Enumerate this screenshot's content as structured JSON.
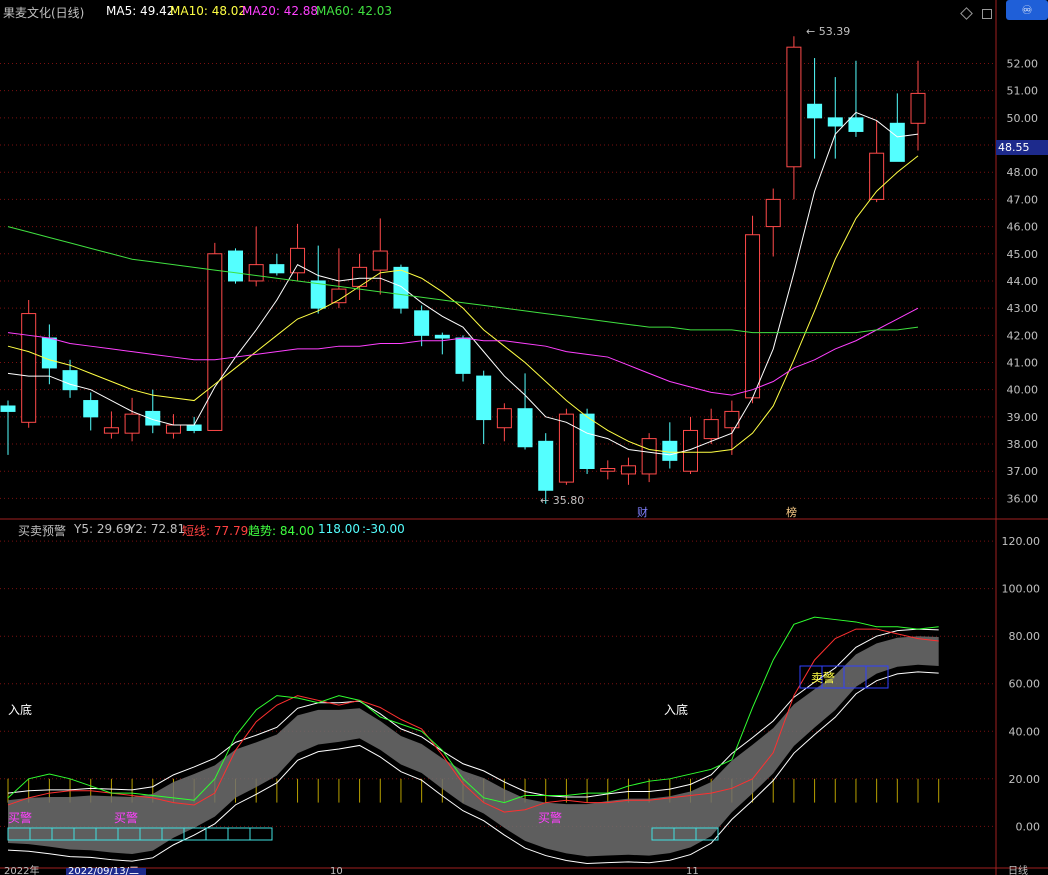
{
  "header": {
    "stock_name": "果麦文化(日线)",
    "ma5": "MA5: 49.42",
    "ma10": "MA10: 48.02",
    "ma20": "MA20: 42.88",
    "ma60": "MA60: 42.03"
  },
  "indicator_header": {
    "name": "买卖预警",
    "y5": "Y5: 29.69",
    "y2": "Y2: 72.81",
    "short": "短线: 77.79",
    "trend": "趋势: 84.00",
    "v118": "118.00",
    "vneg30": ":-30.00"
  },
  "current_price": "48.55",
  "labels": {
    "high": "53.39",
    "low": "35.80",
    "cai": "财",
    "bang": "榜",
    "ru_di_1": "入底",
    "ru_di_2": "入底",
    "mai_jing_1": "买警",
    "mai_jing_2": "买警",
    "mai_jing_3": "买警",
    "mai_jing_sell": "卖警",
    "bottom_left": "2022年",
    "bottom_date": "2022/09/13/二",
    "bottom_mid1": "10",
    "bottom_mid2": "11",
    "bottom_right": "日线"
  },
  "colors": {
    "up": "#ff4a4a",
    "down": "#54ffff",
    "ma5": "#ffffff",
    "ma10": "#ffff44",
    "ma20": "#ff40ff",
    "ma60": "#40e040",
    "grid": "#7a1010"
  },
  "chart_data": [
    {
      "type": "candlestick",
      "title": "果麦文化(日线)",
      "y_ticks": [
        36,
        37,
        38,
        39,
        40,
        41,
        42,
        43,
        44,
        45,
        46,
        47,
        48,
        49,
        50,
        51,
        52
      ],
      "ylim": [
        35.5,
        53.6
      ],
      "candles": [
        {
          "o": 39.4,
          "h": 39.6,
          "l": 37.6,
          "c": 39.2
        },
        {
          "o": 38.8,
          "h": 43.3,
          "l": 38.6,
          "c": 42.8
        },
        {
          "o": 41.9,
          "h": 42.4,
          "l": 40.2,
          "c": 40.8
        },
        {
          "o": 40.7,
          "h": 41.1,
          "l": 39.7,
          "c": 40.0
        },
        {
          "o": 39.6,
          "h": 39.9,
          "l": 38.5,
          "c": 39.0
        },
        {
          "o": 38.4,
          "h": 39.2,
          "l": 38.2,
          "c": 38.6
        },
        {
          "o": 38.4,
          "h": 39.7,
          "l": 38.1,
          "c": 39.1
        },
        {
          "o": 39.2,
          "h": 40.0,
          "l": 38.4,
          "c": 38.7
        },
        {
          "o": 38.4,
          "h": 39.1,
          "l": 38.2,
          "c": 38.7
        },
        {
          "o": 38.7,
          "h": 39.0,
          "l": 38.4,
          "c": 38.5
        },
        {
          "o": 38.5,
          "h": 45.4,
          "l": 38.5,
          "c": 45.0
        },
        {
          "o": 45.1,
          "h": 45.2,
          "l": 43.9,
          "c": 44.0
        },
        {
          "o": 44.0,
          "h": 46.0,
          "l": 43.8,
          "c": 44.6
        },
        {
          "o": 44.6,
          "h": 45.0,
          "l": 44.2,
          "c": 44.3
        },
        {
          "o": 44.3,
          "h": 46.1,
          "l": 44.0,
          "c": 45.2
        },
        {
          "o": 44.0,
          "h": 45.3,
          "l": 42.8,
          "c": 43.0
        },
        {
          "o": 43.2,
          "h": 45.2,
          "l": 43.0,
          "c": 43.7
        },
        {
          "o": 43.8,
          "h": 45.0,
          "l": 43.3,
          "c": 44.5
        },
        {
          "o": 44.4,
          "h": 46.3,
          "l": 43.5,
          "c": 45.1
        },
        {
          "o": 44.5,
          "h": 44.6,
          "l": 42.8,
          "c": 43.0
        },
        {
          "o": 42.9,
          "h": 43.1,
          "l": 41.6,
          "c": 42.0
        },
        {
          "o": 42.0,
          "h": 42.1,
          "l": 41.3,
          "c": 41.9
        },
        {
          "o": 41.9,
          "h": 42.0,
          "l": 40.3,
          "c": 40.6
        },
        {
          "o": 40.5,
          "h": 40.7,
          "l": 38.0,
          "c": 38.9
        },
        {
          "o": 38.6,
          "h": 39.5,
          "l": 38.1,
          "c": 39.3
        },
        {
          "o": 39.3,
          "h": 40.6,
          "l": 37.8,
          "c": 37.9
        },
        {
          "o": 38.1,
          "h": 38.4,
          "l": 35.8,
          "c": 36.3
        },
        {
          "o": 36.6,
          "h": 39.3,
          "l": 36.5,
          "c": 39.1
        },
        {
          "o": 39.1,
          "h": 39.3,
          "l": 36.9,
          "c": 37.1
        },
        {
          "o": 37.0,
          "h": 37.4,
          "l": 36.7,
          "c": 37.1
        },
        {
          "o": 36.9,
          "h": 37.5,
          "l": 36.5,
          "c": 37.2
        },
        {
          "o": 36.9,
          "h": 38.4,
          "l": 36.6,
          "c": 38.2
        },
        {
          "o": 38.1,
          "h": 38.8,
          "l": 37.1,
          "c": 37.4
        },
        {
          "o": 37.0,
          "h": 39.0,
          "l": 36.9,
          "c": 38.5
        },
        {
          "o": 38.2,
          "h": 39.3,
          "l": 38.0,
          "c": 38.9
        },
        {
          "o": 38.6,
          "h": 39.6,
          "l": 37.6,
          "c": 39.2
        },
        {
          "o": 39.7,
          "h": 46.4,
          "l": 39.5,
          "c": 45.7
        },
        {
          "o": 46.0,
          "h": 47.4,
          "l": 44.9,
          "c": 47.0
        },
        {
          "o": 48.2,
          "h": 53.0,
          "l": 47.0,
          "c": 52.6
        },
        {
          "o": 50.5,
          "h": 52.2,
          "l": 48.5,
          "c": 50.0
        },
        {
          "o": 50.0,
          "h": 51.5,
          "l": 48.5,
          "c": 49.7
        },
        {
          "o": 50.0,
          "h": 52.1,
          "l": 49.3,
          "c": 49.5
        },
        {
          "o": 47.0,
          "h": 49.9,
          "l": 46.9,
          "c": 48.7
        },
        {
          "o": 49.8,
          "h": 50.9,
          "l": 48.5,
          "c": 48.4
        },
        {
          "o": 49.8,
          "h": 52.1,
          "l": 48.8,
          "c": 50.9
        }
      ],
      "series": [
        {
          "name": "MA5",
          "values": [
            40.6,
            40.5,
            40.5,
            40.2,
            40.0,
            39.6,
            39.2,
            38.9,
            38.7,
            38.7,
            40.1,
            41.2,
            42.2,
            43.3,
            44.6,
            44.2,
            44.0,
            44.1,
            44.1,
            43.8,
            43.2,
            42.7,
            42.3,
            41.4,
            40.5,
            39.8,
            39.0,
            38.8,
            38.4,
            38.2,
            37.8,
            37.7,
            37.6,
            37.8,
            38.1,
            38.4,
            39.7,
            41.5,
            44.3,
            47.3,
            49.4,
            50.2,
            49.9,
            49.3,
            49.4
          ]
        },
        {
          "name": "MA10",
          "values": [
            41.6,
            41.4,
            41.1,
            40.9,
            40.6,
            40.3,
            40.0,
            39.8,
            39.7,
            39.6,
            40.2,
            40.8,
            41.4,
            42.0,
            42.6,
            42.9,
            43.3,
            43.8,
            44.3,
            44.4,
            44.1,
            43.6,
            43.0,
            42.2,
            41.6,
            41.0,
            40.3,
            39.6,
            39.0,
            38.5,
            38.1,
            37.8,
            37.7,
            37.7,
            37.7,
            37.8,
            38.4,
            39.4,
            41.1,
            42.9,
            44.8,
            46.3,
            47.3,
            48.0,
            48.6
          ]
        },
        {
          "name": "MA20",
          "values": [
            42.1,
            42.0,
            41.9,
            41.7,
            41.6,
            41.5,
            41.4,
            41.3,
            41.2,
            41.1,
            41.1,
            41.2,
            41.3,
            41.4,
            41.5,
            41.5,
            41.6,
            41.6,
            41.7,
            41.7,
            41.8,
            41.8,
            41.9,
            41.8,
            41.8,
            41.7,
            41.6,
            41.4,
            41.3,
            41.2,
            40.9,
            40.6,
            40.3,
            40.1,
            39.9,
            39.8,
            40.0,
            40.3,
            40.8,
            41.1,
            41.5,
            41.8,
            42.2,
            42.6,
            43.0
          ]
        },
        {
          "name": "MA60",
          "values": [
            46.0,
            45.8,
            45.6,
            45.4,
            45.2,
            45.0,
            44.8,
            44.7,
            44.6,
            44.5,
            44.4,
            44.3,
            44.2,
            44.1,
            44.0,
            43.9,
            43.8,
            43.7,
            43.6,
            43.5,
            43.4,
            43.3,
            43.2,
            43.1,
            43.0,
            42.9,
            42.8,
            42.7,
            42.6,
            42.5,
            42.4,
            42.3,
            42.3,
            42.2,
            42.2,
            42.2,
            42.1,
            42.1,
            42.1,
            42.1,
            42.1,
            42.1,
            42.2,
            42.2,
            42.3
          ]
        }
      ]
    },
    {
      "type": "line",
      "title": "买卖预警",
      "y_ticks": [
        0,
        20,
        40,
        60,
        80,
        100,
        120
      ],
      "ylim": [
        -15,
        123
      ],
      "series": [
        {
          "name": "短线",
          "values": [
            9,
            12,
            14,
            15,
            15,
            14,
            13,
            12,
            10,
            9,
            14,
            32,
            44,
            51,
            55,
            53,
            51,
            53,
            50,
            45,
            41,
            30,
            18,
            10,
            6,
            7,
            10,
            11,
            10,
            10,
            11,
            11,
            12,
            13,
            14,
            16,
            20,
            31,
            55,
            70,
            79,
            83,
            83,
            81,
            79,
            78
          ]
        },
        {
          "name": "趋势",
          "values": [
            12,
            20,
            22,
            20,
            17,
            14,
            14,
            13,
            12,
            11,
            20,
            38,
            49,
            55,
            54,
            52,
            55,
            53,
            46,
            43,
            40,
            32,
            20,
            12,
            10,
            13,
            13,
            13,
            14,
            14,
            17,
            19,
            20,
            22,
            24,
            28,
            50,
            70,
            85,
            88,
            87,
            86,
            84,
            84,
            83,
            84
          ]
        }
      ]
    }
  ]
}
